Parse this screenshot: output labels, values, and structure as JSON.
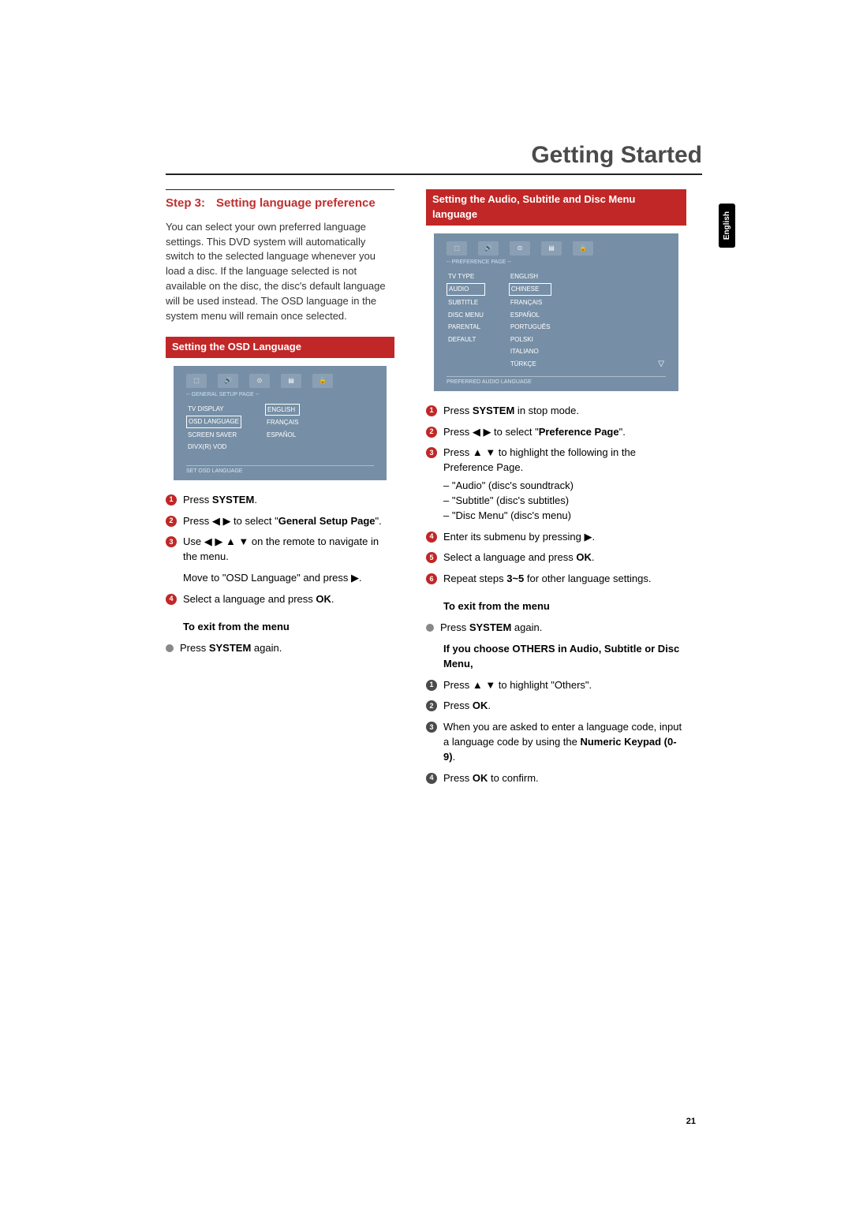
{
  "header": {
    "title": "Getting Started",
    "lang_tab": "English"
  },
  "left": {
    "step": {
      "label": "Step 3:",
      "title": "Setting language preference"
    },
    "intro": "You can select your own preferred language settings. This DVD system will automatically switch to the selected language whenever you load a disc. If the language selected is not available on the disc, the disc's default language will be used instead. The OSD language in the system menu will remain once selected.",
    "osd_header": "Setting the OSD Language",
    "mock1": {
      "title": "-- GENERAL SETUP PAGE --",
      "left_items": [
        "TV DISPLAY",
        "OSD LANGUAGE",
        "SCREEN SAVER",
        "DIVX(R) VOD"
      ],
      "left_selected_index": 1,
      "right_items": [
        "ENGLISH",
        "FRANÇAIS",
        "ESPAÑOL"
      ],
      "right_selected_index": 0,
      "footer": "SET OSD LANGUAGE"
    },
    "steps": {
      "s1_a": "Press ",
      "s1_b": "SYSTEM",
      "s1_c": ".",
      "s2_a": "Press ◀ ▶ to select \"",
      "s2_b": "General Setup Page",
      "s2_c": "\".",
      "s3": "Use ◀ ▶ ▲ ▼ on the remote to navigate in the menu.",
      "s3_extra": "Move to \"OSD Language\" and press ▶.",
      "s4_a": "Select a language and press ",
      "s4_b": "OK",
      "s4_c": "."
    },
    "exit_hdr": "To exit from the menu",
    "exit_a": "Press ",
    "exit_b": "SYSTEM",
    "exit_c": " again."
  },
  "right": {
    "audio_header": "Setting the Audio, Subtitle and Disc Menu language",
    "mock2": {
      "title": "-- PREFERENCE PAGE --",
      "left_items": [
        "TV TYPE",
        "AUDIO",
        "SUBTITLE",
        "DISC MENU",
        "PARENTAL",
        "DEFAULT"
      ],
      "left_selected_index": 1,
      "right_items": [
        "ENGLISH",
        "CHINESE",
        "FRANÇAIS",
        "ESPAÑOL",
        "PORTUGUÊS",
        "POLSKI",
        "ITALIANO",
        "TÜRKÇE"
      ],
      "right_selected_index": 1,
      "footer": "PREFERRED AUDIO LANGUAGE"
    },
    "steps": {
      "s1_a": "Press ",
      "s1_b": "SYSTEM",
      "s1_c": " in stop mode.",
      "s2_a": "Press ◀ ▶ to select \"",
      "s2_b": "Preference Page",
      "s2_c": "\".",
      "s3": "Press ▲ ▼ to highlight the following in the Preference Page.",
      "s3_list": [
        "\"Audio\" (disc's soundtrack)",
        "\"Subtitle\" (disc's subtitles)",
        "\"Disc Menu\" (disc's menu)"
      ],
      "s4": "Enter its submenu by pressing ▶.",
      "s5_a": "Select a language and press ",
      "s5_b": "OK",
      "s5_c": ".",
      "s6_a": "Repeat steps ",
      "s6_b": "3~5",
      "s6_c": " for other language settings."
    },
    "exit_hdr": "To exit from the menu",
    "exit_a": "Press ",
    "exit_b": "SYSTEM",
    "exit_c": " again.",
    "others_hdr": "If you choose OTHERS in Audio, Subtitle or Disc Menu,",
    "others": {
      "o1": "Press ▲ ▼ to highlight \"Others\".",
      "o2_a": "Press ",
      "o2_b": "OK",
      "o2_c": ".",
      "o3_a": "When you are asked to enter a language code, input a language code by using the ",
      "o3_b": "Numeric Keypad (0-9)",
      "o3_c": ".",
      "o4_a": "Press ",
      "o4_b": "OK",
      "o4_c": " to confirm."
    }
  },
  "page_number": "21"
}
